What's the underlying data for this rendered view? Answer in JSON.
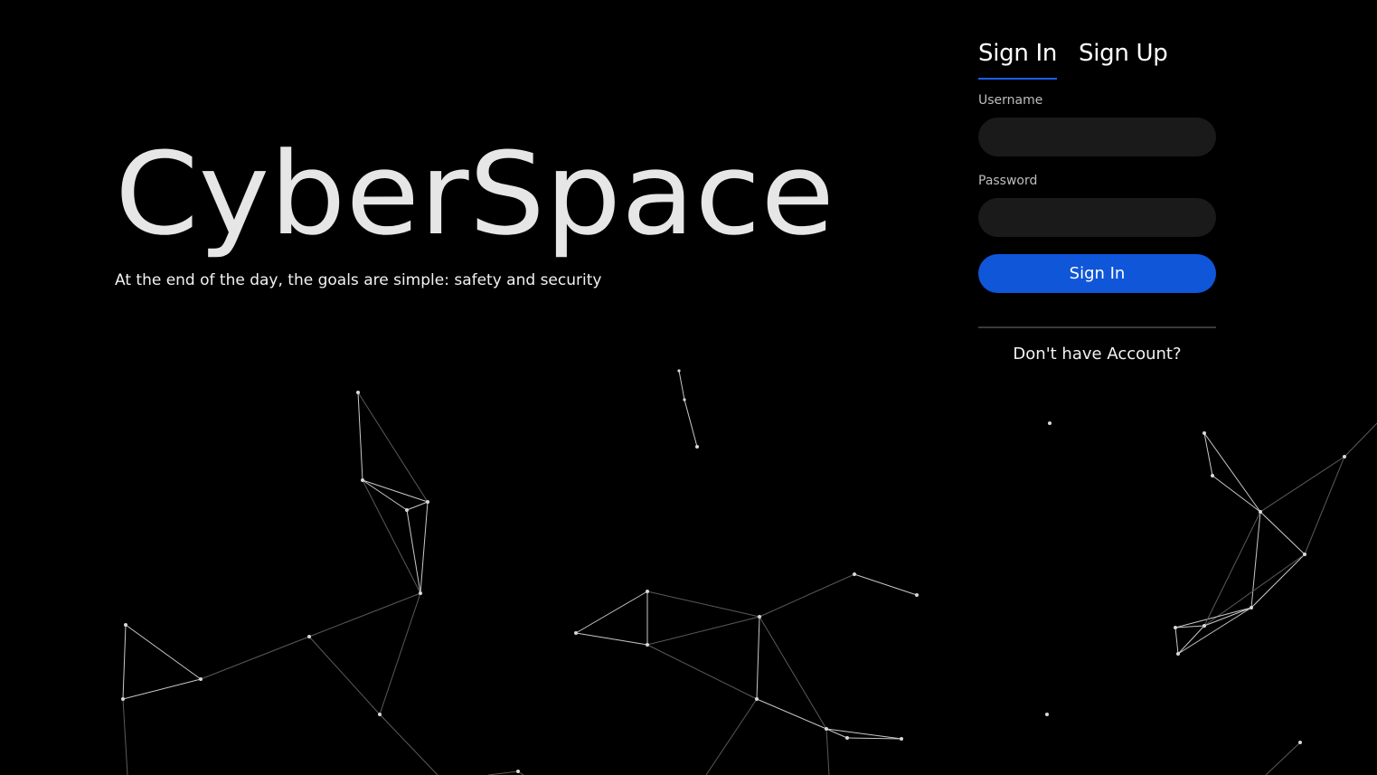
{
  "hero": {
    "title": "CyberSpace",
    "tagline": "At the end of the day, the goals are simple: safety and security"
  },
  "auth": {
    "tabs": [
      {
        "label": "Sign In",
        "active": true
      },
      {
        "label": "Sign Up",
        "active": false
      }
    ],
    "username_label": "Username",
    "username_value": "",
    "password_label": "Password",
    "password_value": "",
    "submit_label": "Sign In",
    "no_account_label": "Don't have Account?"
  },
  "colors": {
    "background": "#000000",
    "accent": "#0f56d8",
    "tab_underline": "#1c5ff0",
    "input_background": "#1a1a1a"
  }
}
